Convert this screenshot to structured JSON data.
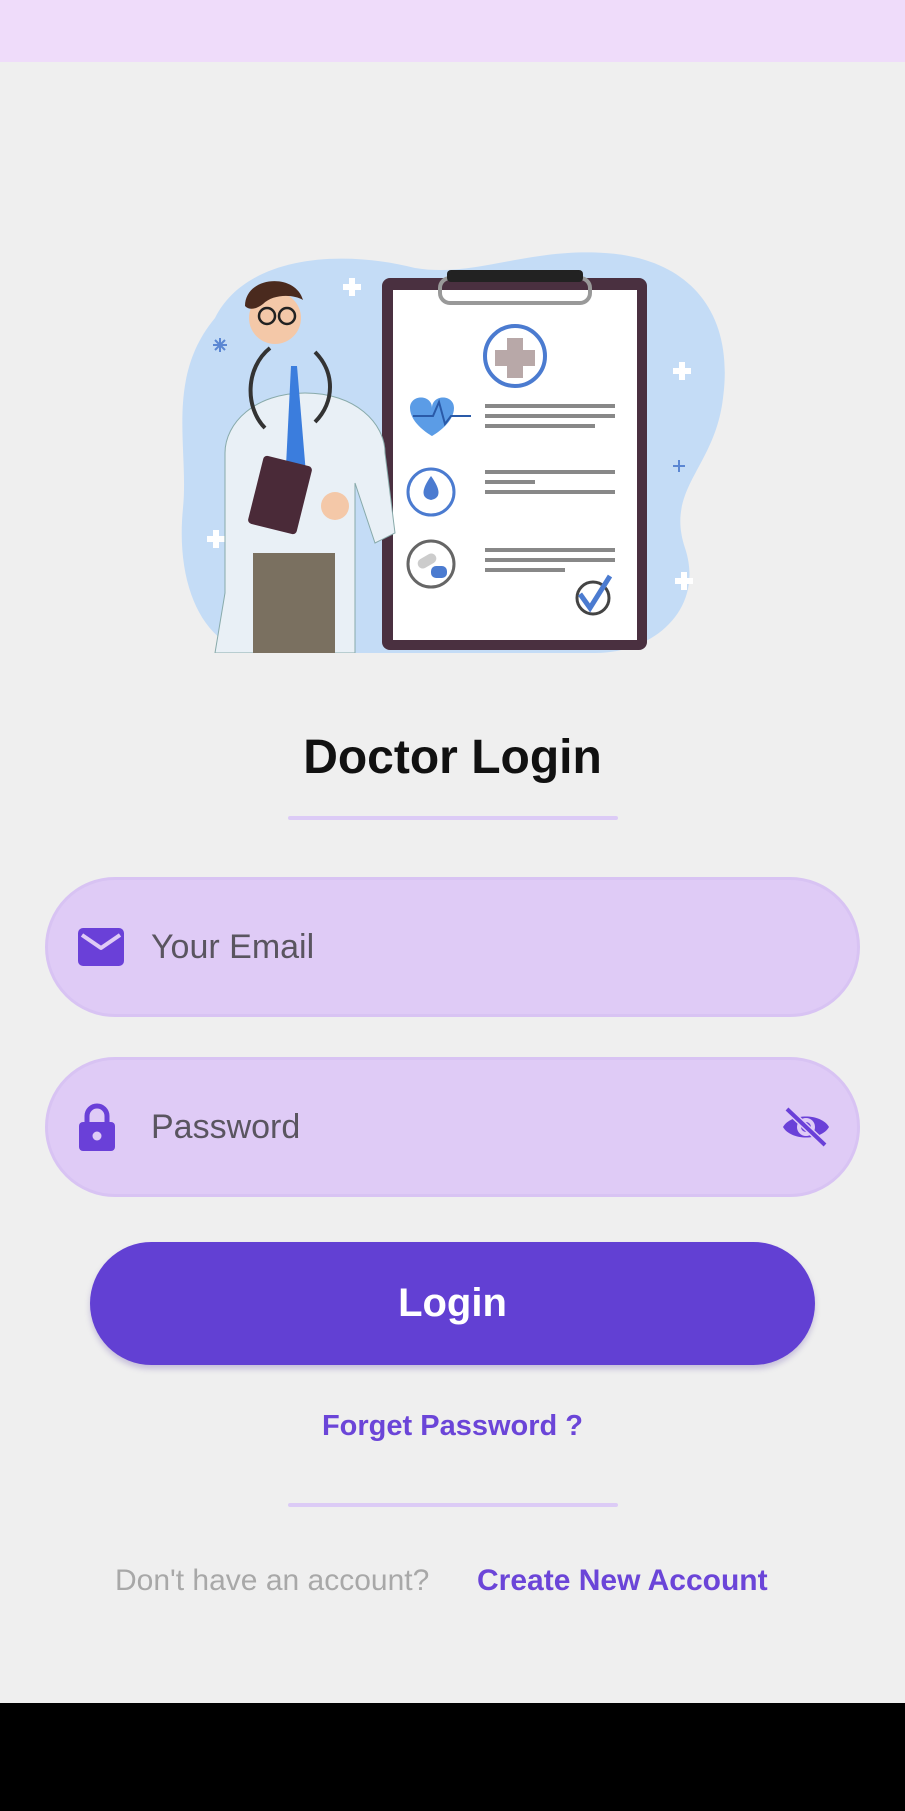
{
  "colors": {
    "accent": "#6240d3",
    "field_bg": "#dfcbf6",
    "page_bg": "#efefef",
    "status_bar": "#efdcfa"
  },
  "illustration": {
    "icon": "doctor-clipboard-illustration"
  },
  "title": "Doctor Login",
  "email_field": {
    "placeholder": "Your Email",
    "value": "",
    "icon": "envelope-icon"
  },
  "password_field": {
    "placeholder": "Password",
    "value": "",
    "icon": "lock-icon",
    "toggle_icon": "eye-off-icon"
  },
  "login_button": "Login",
  "forget_password": "Forget Password ?",
  "signup": {
    "prompt": "Don't have an account?",
    "link": "Create New Account"
  }
}
